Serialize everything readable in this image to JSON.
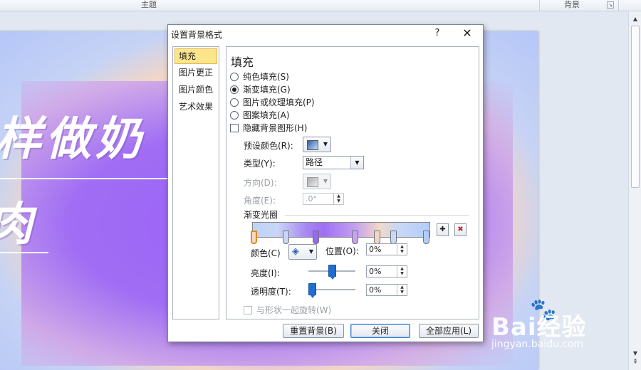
{
  "ribbon": {
    "group_theme": "主题",
    "group_background": "背景"
  },
  "slide": {
    "line1": "样做奶",
    "line2": "肉"
  },
  "dialog": {
    "title": "设置背景格式",
    "help": "?",
    "close": "✕",
    "nav": [
      "填充",
      "图片更正",
      "图片颜色",
      "艺术效果"
    ],
    "fill": {
      "heading": "填充",
      "options": [
        "纯色填充(S)",
        "渐变填充(G)",
        "图片或纹理填充(P)",
        "图案填充(A)"
      ],
      "selected_option": "渐变填充(G)",
      "hide_background": "隐藏背景图形(H)",
      "preset_label": "预设颜色(R):",
      "type_label": "类型(Y):",
      "type_value": "路径",
      "direction_label": "方向(D):",
      "angle_label": "角度(E):",
      "angle_value": ".0°",
      "stops_label": "渐变光圈",
      "color_label": "颜色(C)",
      "position_label": "位置(O):",
      "position_value": "0%",
      "brightness_label": "亮度(I):",
      "brightness_value": "0%",
      "brightness_level": 0.5,
      "transparency_label": "透明度(T):",
      "transparency_value": "0%",
      "transparency_level": 0.0,
      "rotate_label": "与形状一起旋转(W)"
    },
    "buttons": {
      "reset": "重置背景(B)",
      "close": "关闭",
      "apply_all": "全部应用(L)"
    }
  },
  "watermark": {
    "brand": "Bai经验",
    "url": "jingyan.baidu.com"
  },
  "colors": {
    "accent": "#1f6fd1",
    "nav_active": "#fde58c",
    "selected_stop": "#e08c22"
  }
}
